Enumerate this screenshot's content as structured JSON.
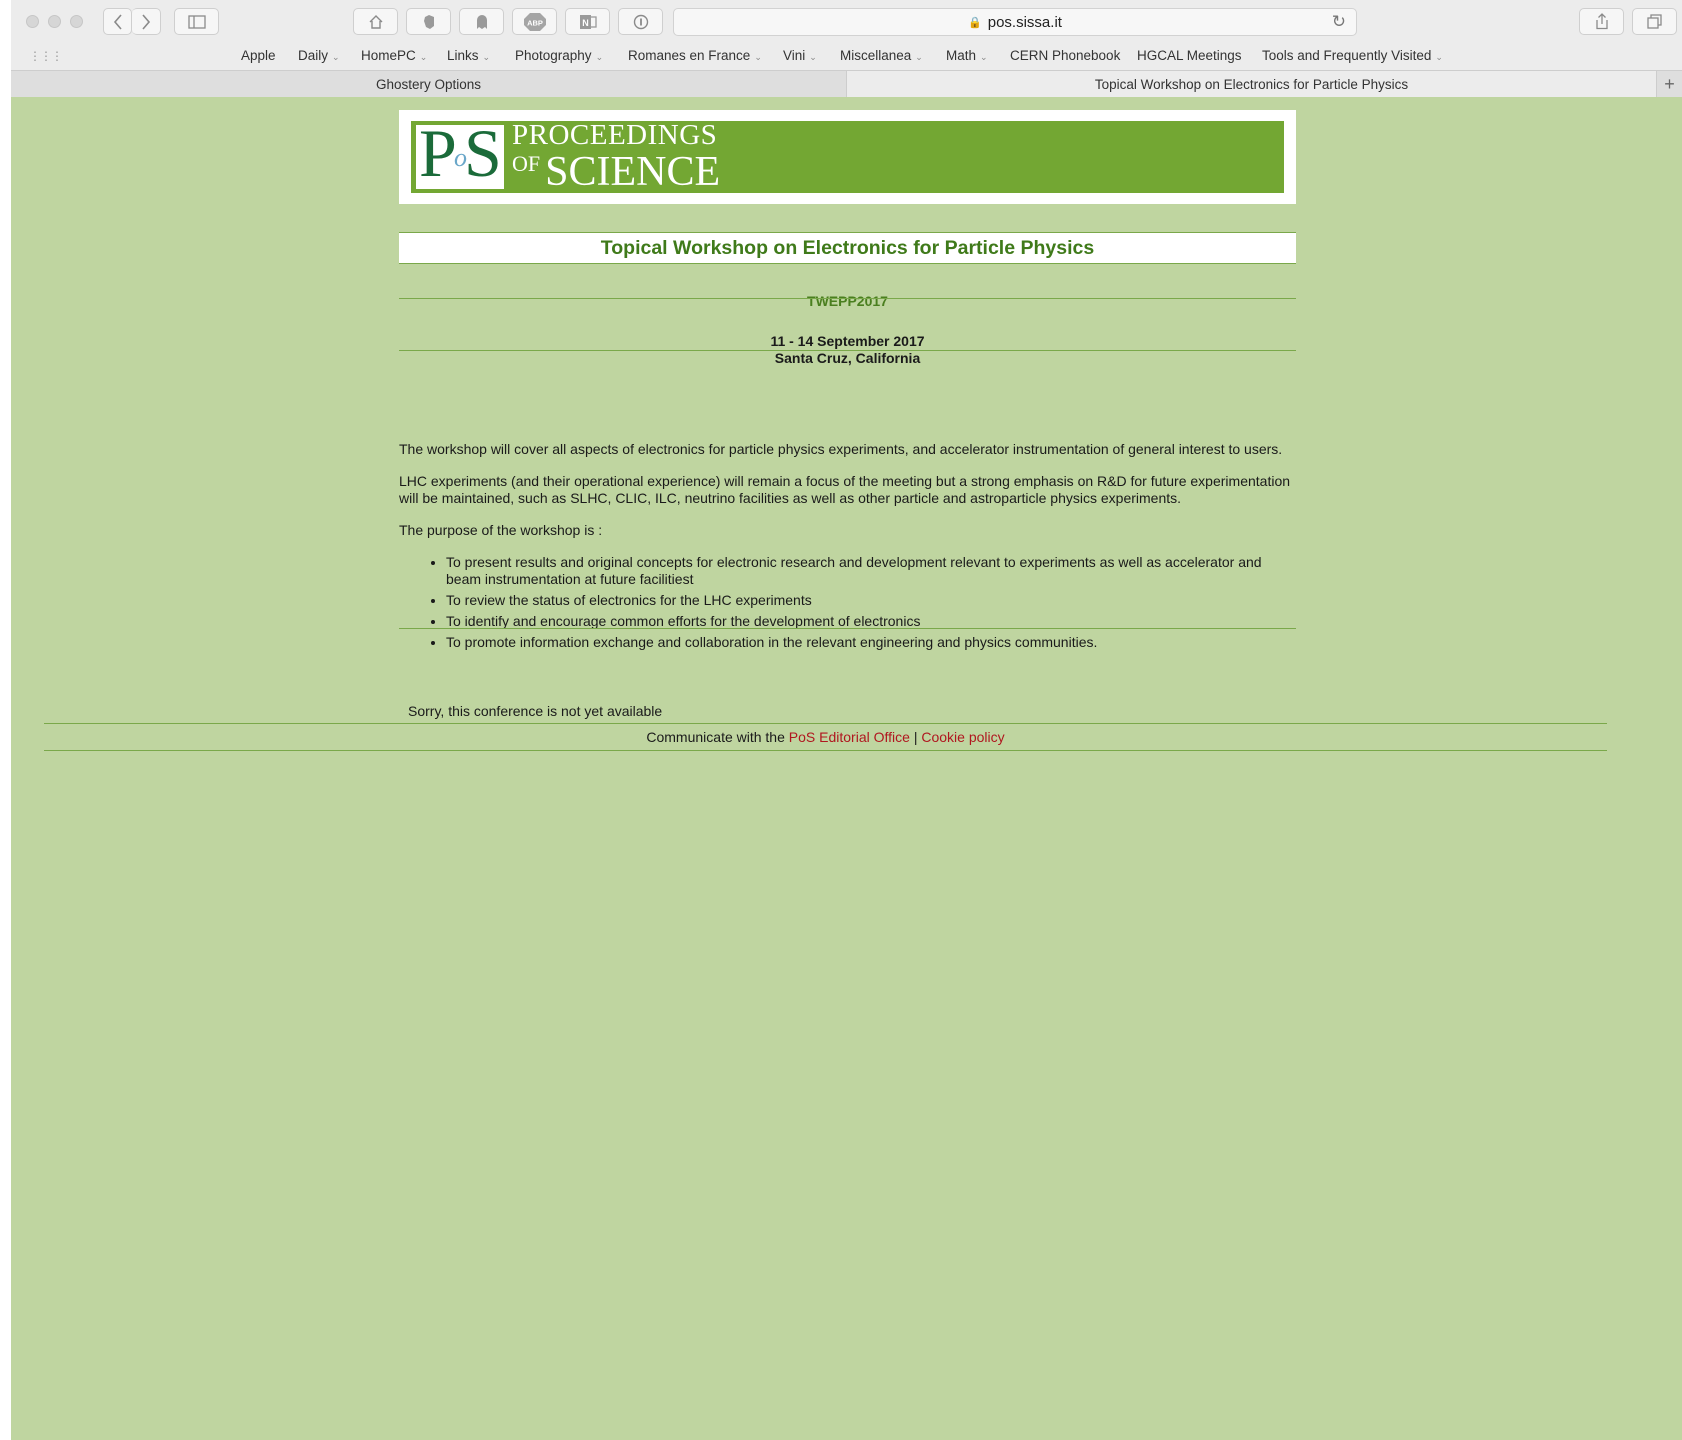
{
  "browser": {
    "url": "pos.sissa.it",
    "bookmarks": [
      {
        "label": "Apple",
        "has_menu": false
      },
      {
        "label": "Daily",
        "has_menu": true
      },
      {
        "label": "HomePC",
        "has_menu": true
      },
      {
        "label": "Links",
        "has_menu": true
      },
      {
        "label": "Photography",
        "has_menu": true
      },
      {
        "label": "Romanes en France",
        "has_menu": true
      },
      {
        "label": "Vini",
        "has_menu": true
      },
      {
        "label": "Miscellanea",
        "has_menu": true
      },
      {
        "label": "Math",
        "has_menu": true
      },
      {
        "label": "CERN Phonebook",
        "has_menu": false
      },
      {
        "label": "HGCAL Meetings",
        "has_menu": false
      },
      {
        "label": "Tools and Frequently Visited",
        "has_menu": true
      }
    ],
    "tabs": [
      {
        "label": "Ghostery Options",
        "active": false
      },
      {
        "label": "Topical Workshop on Electronics for Particle Physics",
        "active": true
      }
    ],
    "toolbar_icons": [
      "home-icon",
      "evernote-icon",
      "ghostery-icon",
      "adblock-icon",
      "onenote-icon",
      "password-icon"
    ],
    "abp_label": "ABP"
  },
  "banner": {
    "line1": "PROCEEDINGS",
    "of": "OF",
    "line2": "SCIENCE",
    "logo_p": "P",
    "logo_o": "o",
    "logo_s": "S",
    "colors": {
      "banner_green": "#73a733",
      "logo_green": "#1b6b3a"
    }
  },
  "conference": {
    "title": "Topical Workshop on Electronics for Particle Physics",
    "acronym": "TWEPP2017",
    "dates": "11 - 14 September 2017",
    "location": "Santa Cruz, California"
  },
  "description": {
    "para1": "The workshop will cover all aspects of electronics for particle physics experiments, and accelerator instrumentation of general interest to users.",
    "para2": "LHC experiments (and their operational experience) will remain a focus of the meeting but a strong emphasis on R&D for future experimentation will be maintained, such as SLHC, CLIC, ILC, neutrino facilities as well as other particle and astroparticle physics experiments.",
    "purpose_intro": "The purpose of the workshop is :",
    "purposes": [
      "To present results and original concepts for electronic research and development relevant to experiments as well as accelerator and beam instrumentation at future facilitiest",
      "To review the status of electronics for the LHC experiments",
      "To identify and encourage common efforts for the development of electronics",
      "To promote information exchange and collaboration in the relevant engineering and physics communities."
    ]
  },
  "status": {
    "message": "Sorry, this conference is not yet available"
  },
  "footer": {
    "prefix": "Communicate with the",
    "editorial_link": "PoS Editorial Office",
    "separator": "|",
    "cookie_link": "Cookie policy"
  },
  "colors": {
    "page_background": "#bfd5a0",
    "title_green": "#3f7a1a",
    "link_red": "#b0171f"
  }
}
